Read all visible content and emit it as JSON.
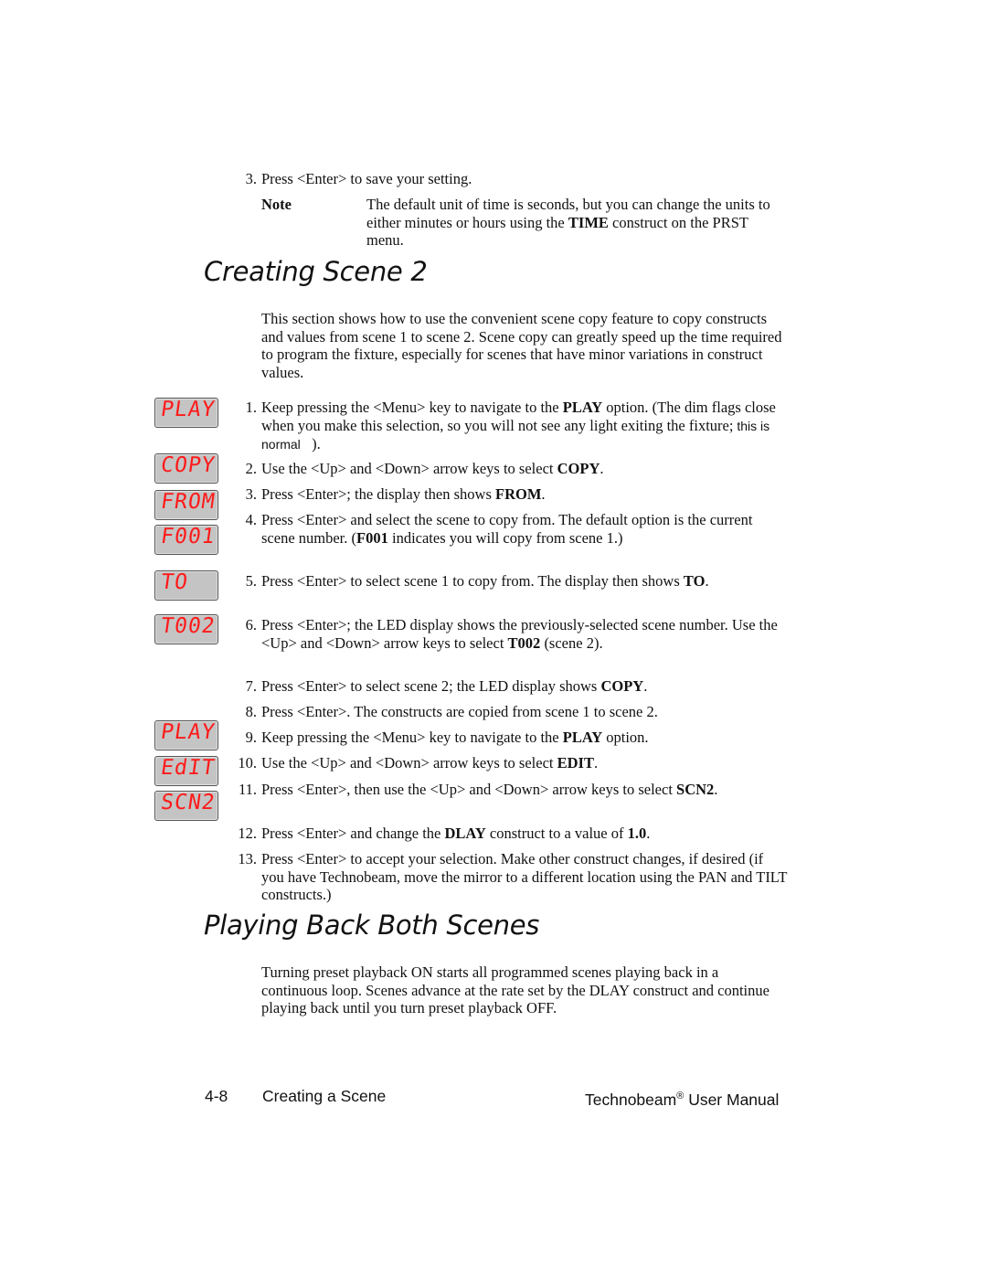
{
  "top": {
    "step3_num": "3.",
    "step3_text": "Press <Enter> to save your setting.",
    "note_label": "Note",
    "note_text_1": "The default unit of time is seconds, but you can change the units to either minutes or hours using the ",
    "note_bold": "TIME",
    "note_text_2": "construct on the PRST menu."
  },
  "section1": {
    "heading": "Creating Scene 2",
    "intro": "This section shows how to use the convenient scene copy feature to copy constructs and values from scene 1 to scene 2.  Scene copy can greatly speed up the time required to program the fixture, especially for scenes that have minor variations in construct values."
  },
  "led_displays": [
    {
      "label": "PLAY"
    },
    {
      "label": "COPY"
    },
    {
      "label": "FROM"
    },
    {
      "label": "F001"
    },
    {
      "label": "TO"
    },
    {
      "label": "T002"
    },
    {
      "label": "PLAY"
    },
    {
      "label": "EdIT"
    },
    {
      "label": "SCN2"
    }
  ],
  "steps": [
    {
      "num": "1.",
      "a": "Keep pressing the <Menu> key to navigate to the ",
      "b": "PLAY",
      "c": " option.  (The dim flags close when you make this selection, so you will not see any light exiting the fixture;",
      "d": " this is normal",
      "e": "   )."
    },
    {
      "num": "2.",
      "a": "Use the <Up> and <Down> arrow keys to select ",
      "b": "COPY",
      "c": "."
    },
    {
      "num": "3.",
      "a": "Press <Enter>; the display then shows ",
      "b": "FROM",
      "c": "."
    },
    {
      "num": "4.",
      "a": "Press <Enter> and select the scene to copy from.  The default option is the current scene number.  (",
      "b": "F001",
      "c": " indicates you will copy from scene 1.)"
    },
    {
      "num": "5.",
      "a": "Press <Enter> to select scene 1 to copy from.  The display then shows ",
      "b": "TO",
      "c": "."
    },
    {
      "num": "6.",
      "a": "Press <Enter>; the LED display shows the previously-selected scene number.  Use the <Up> and <Down> arrow keys to select ",
      "b": "T002",
      "c": " (scene 2)."
    },
    {
      "num": "7.",
      "a": "Press <Enter> to select scene 2; the LED display shows ",
      "b": "COPY",
      "c": "."
    },
    {
      "num": "8.",
      "a": "Press <Enter>.  The constructs are copied from scene 1 to scene 2."
    },
    {
      "num": "9.",
      "a": "Keep pressing the <Menu> key to navigate to the ",
      "b": "PLAY",
      "c": " option."
    },
    {
      "num": "10.",
      "a": "Use the <Up> and <Down> arrow keys to select ",
      "b": "EDIT",
      "c": "."
    },
    {
      "num": "11.",
      "a": "Press <Enter>, then use the <Up> and <Down> arrow keys to select ",
      "b": "SCN2",
      "c": "."
    },
    {
      "num": "12.",
      "a": "Press <Enter> and change the ",
      "b": "DLAY",
      "c": " construct to a value of ",
      "d": "1.0",
      "e": "."
    },
    {
      "num": "13.",
      "a": "Press <Enter> to accept your selection.  Make other construct changes, if desired (if you have Technobeam, move the mirror to a different location using the PAN and TILT constructs.)"
    }
  ],
  "section2": {
    "heading": "Playing Back Both Scenes",
    "text": "Turning preset playback ON starts all programmed scenes playing back in a continuous loop.  Scenes advance at the rate set by the DLAY construct and continue playing back until you turn preset playback OFF."
  },
  "footer": {
    "page_number": "4-8",
    "chapter": "Creating a Scene",
    "manual_title": "Technobeam",
    "registered": "®",
    "manual_suffix": " User Manual"
  }
}
